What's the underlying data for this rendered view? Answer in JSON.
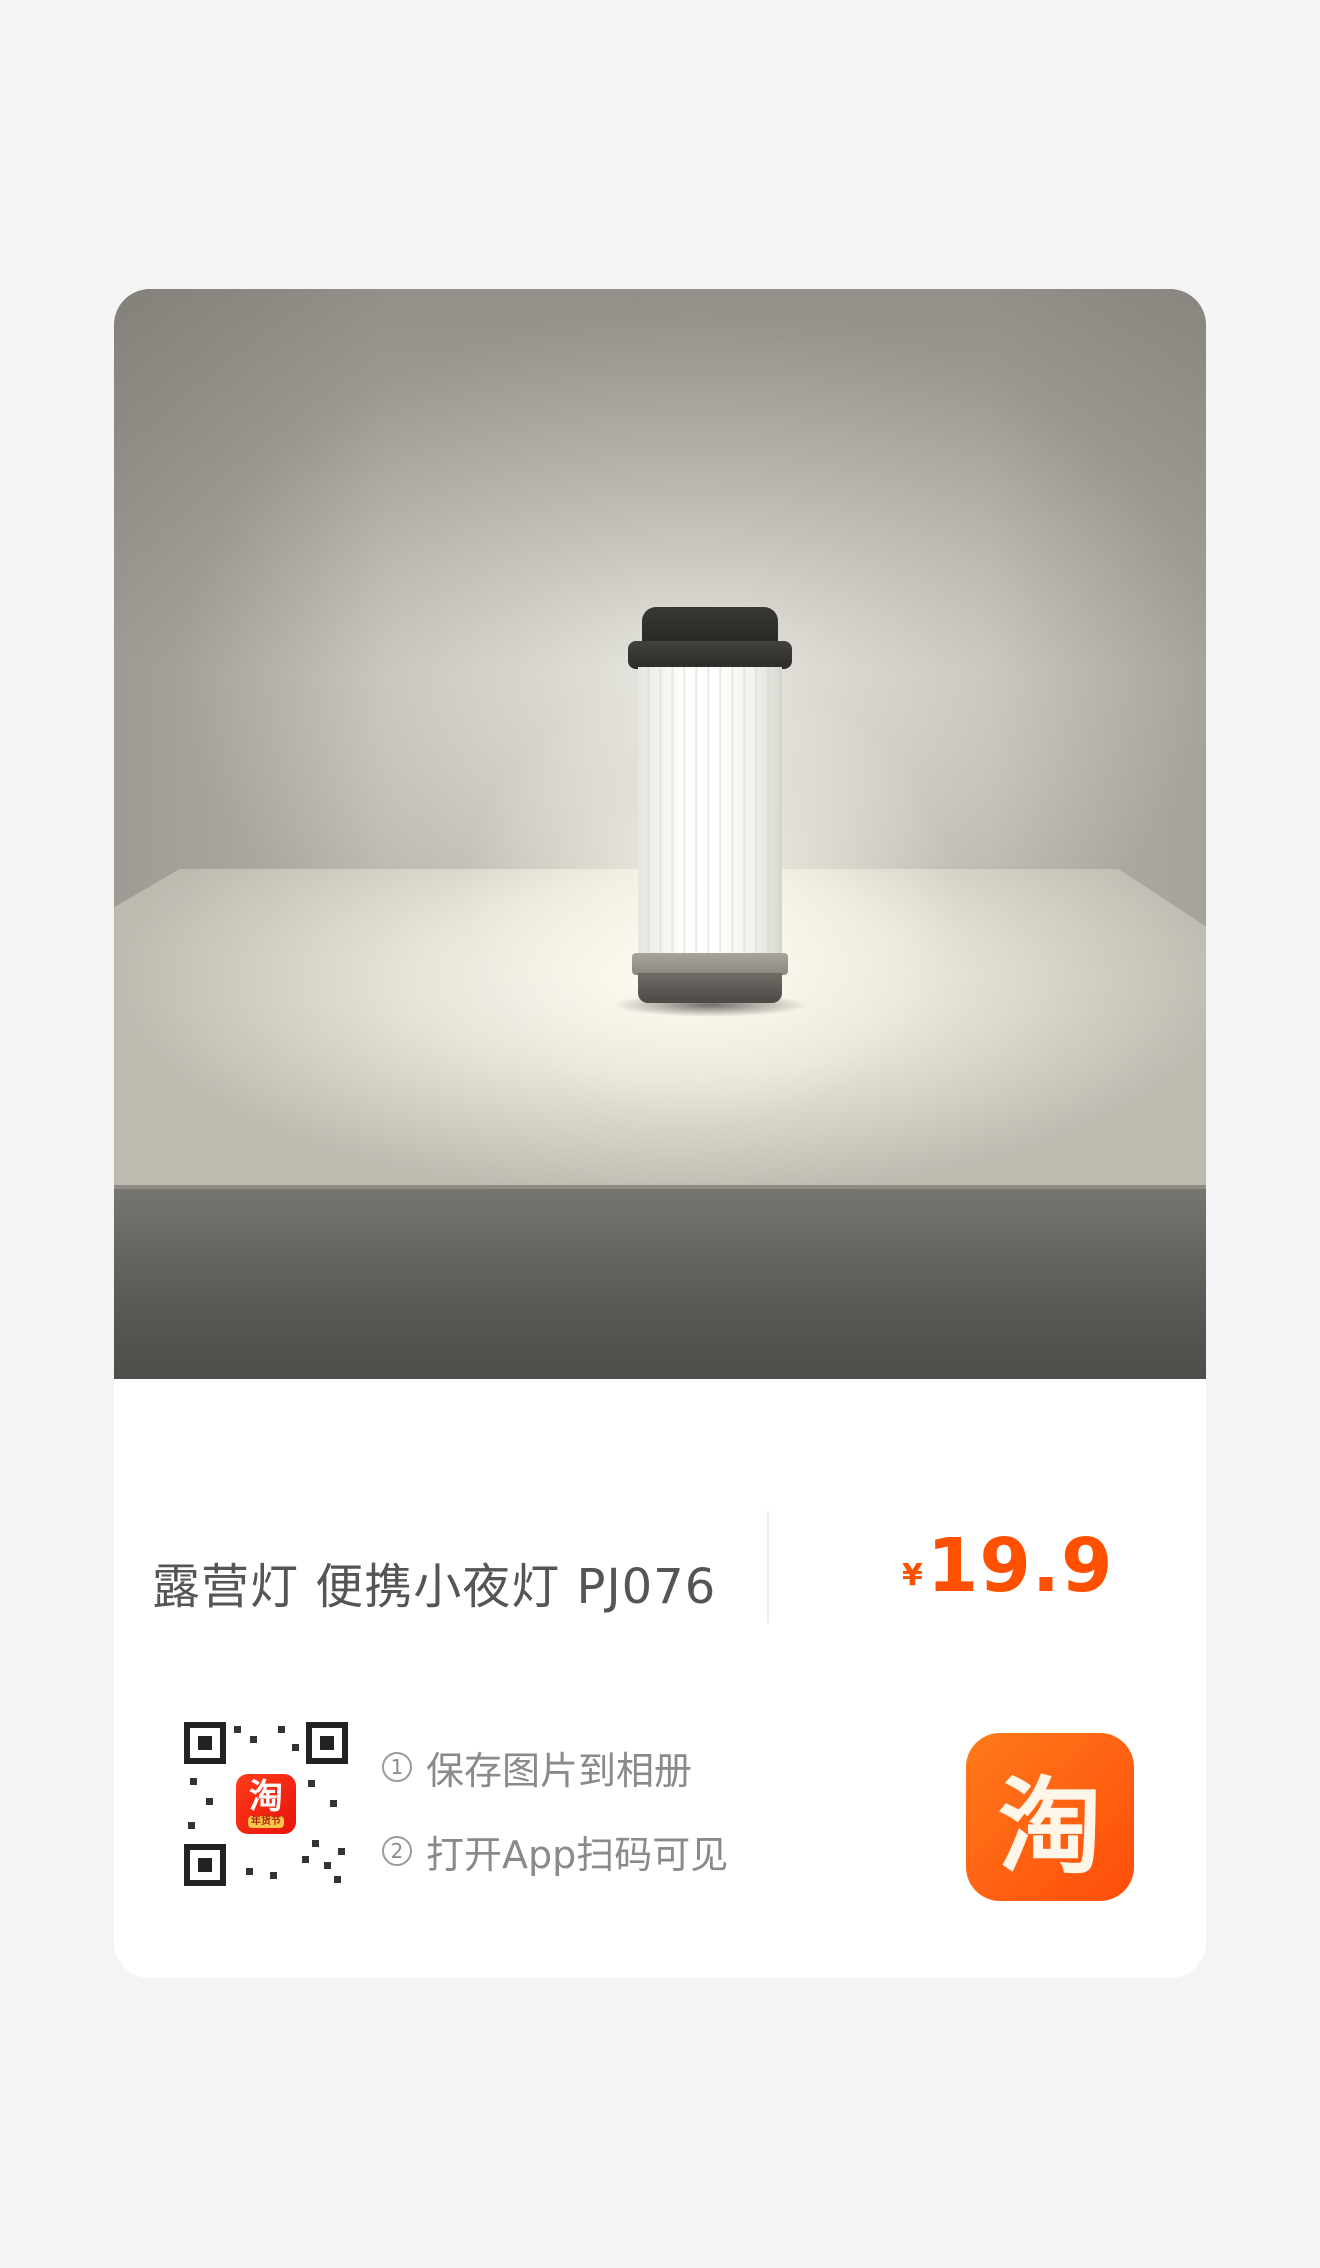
{
  "product": {
    "title": "露营灯 便携小夜灯 PJ076",
    "price_symbol": "¥",
    "price": "19.9"
  },
  "qr": {
    "logo_text": "淘",
    "logo_badge": "年货节"
  },
  "steps": [
    {
      "number": "1",
      "text": "保存图片到相册"
    },
    {
      "number": "2",
      "text": "打开App扫码可见"
    }
  ],
  "app_logo": {
    "text": "淘",
    "icon": "taobao-icon"
  },
  "colors": {
    "price": "#ff5000",
    "brand": "#ff5a0a",
    "background": "#f4f4f4"
  }
}
